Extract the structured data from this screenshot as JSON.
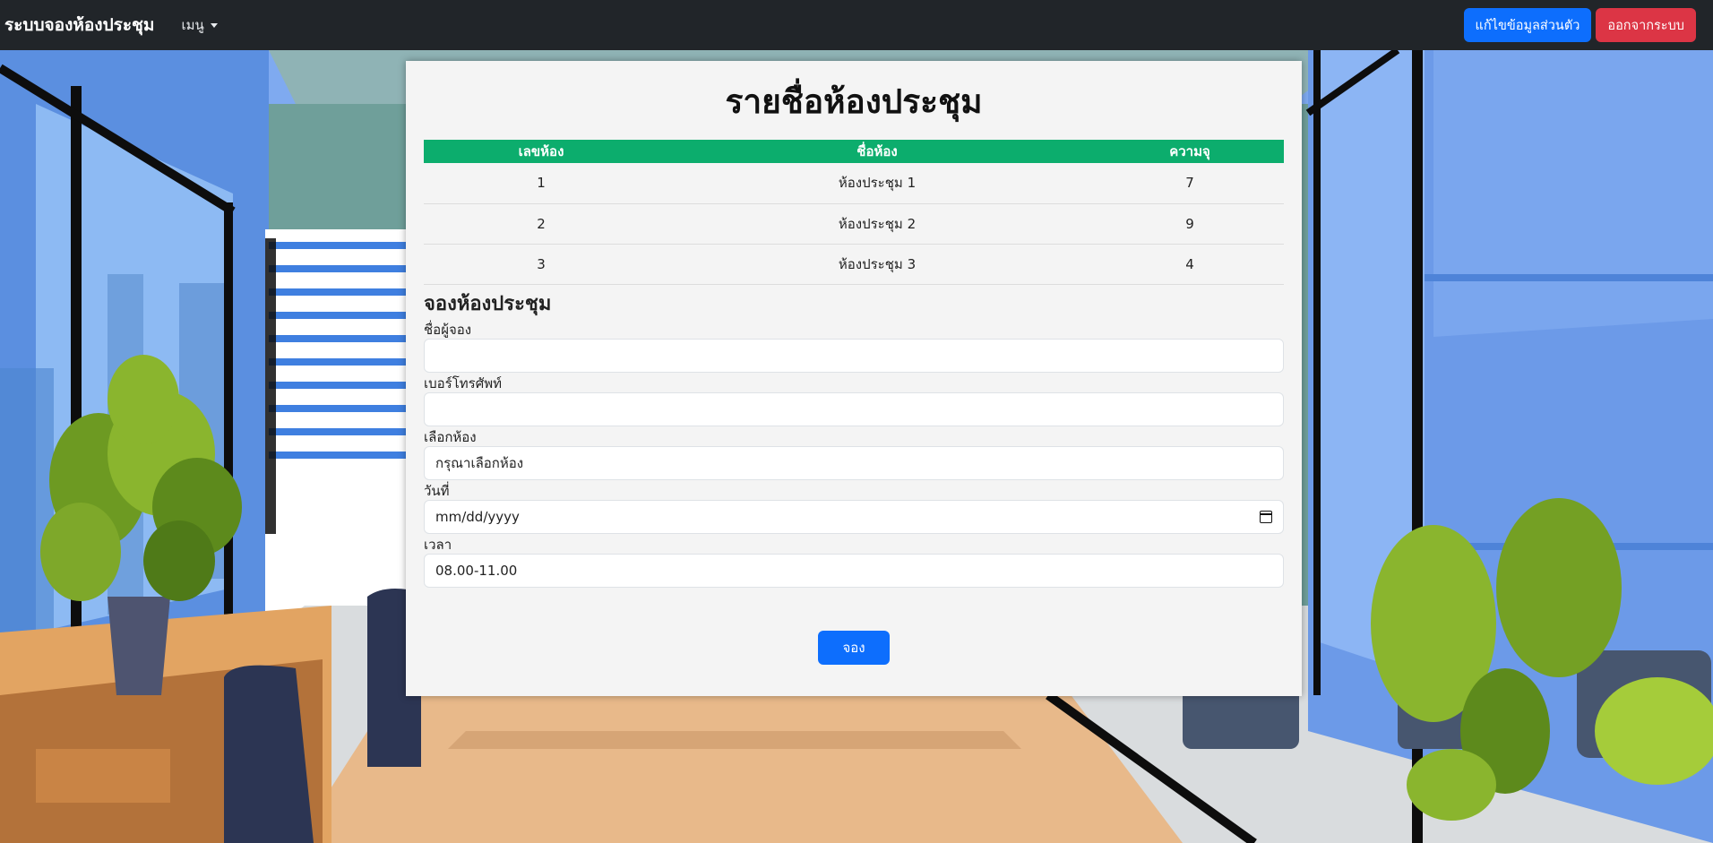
{
  "navbar": {
    "brand": "ระบบจองห้องประชุม",
    "menu_label": "เมนู",
    "edit_profile_label": "แก้ไขข้อมูลส่วนตัว",
    "logout_label": "ออกจากระบบ"
  },
  "colors": {
    "navbar_bg": "#212529",
    "table_header": "#0cad6d",
    "primary": "#0d6efd",
    "danger": "#dc3545"
  },
  "page_title": "รายชื่อห้องประชุม",
  "room_table": {
    "headers": [
      "เลขห้อง",
      "ชื่อห้อง",
      "ความจุ"
    ],
    "rows": [
      [
        "1",
        "ห้องประชุม 1",
        "7"
      ],
      [
        "2",
        "ห้องประชุม 2",
        "9"
      ],
      [
        "3",
        "ห้องประชุม 3",
        "4"
      ]
    ]
  },
  "booking_form": {
    "title": "จองห้องประชุม",
    "name_label": "ชื่อผู้จอง",
    "name_value": "",
    "phone_label": "เบอร์โทรศัพท์",
    "phone_value": "",
    "room_label": "เลือกห้อง",
    "room_selected": "กรุณาเลือกห้อง",
    "date_label": "วันที่",
    "date_placeholder": "mm/dd/yyyy",
    "time_label": "เวลา",
    "time_selected": "08.00-11.00",
    "submit_label": "จอง"
  }
}
